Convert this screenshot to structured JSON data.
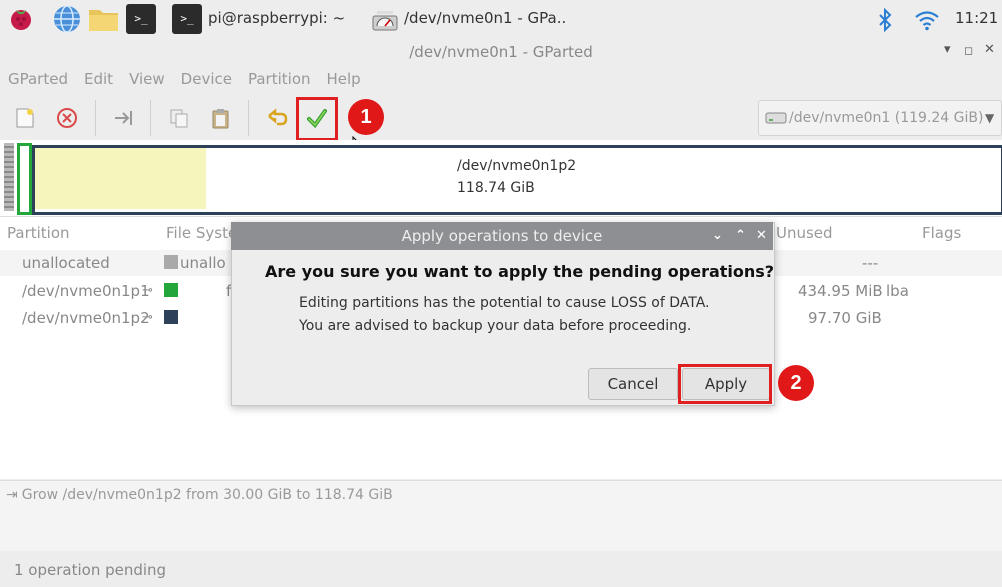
{
  "taskbar": {
    "terminal_window_label": "pi@raspberrypi: ~",
    "gparted_window_label": "/dev/nvme0n1 - GPa..",
    "clock": "11:21"
  },
  "window": {
    "title": "/dev/nvme0n1 - GParted"
  },
  "menu": [
    "GParted",
    "Edit",
    "View",
    "Device",
    "Partition",
    "Help"
  ],
  "device_selector": {
    "value": "/dev/nvme0n1 (119.24 GiB)"
  },
  "partition_map": {
    "name": "/dev/nvme0n1p2",
    "size": "118.74 GiB"
  },
  "list": {
    "headers": {
      "partition": "Partition",
      "filesystem": "File Syste",
      "unused": "Unused",
      "flags": "Flags"
    },
    "rows": [
      {
        "partition": "unallocated",
        "filesystem": "unallo",
        "unused": "---",
        "flags": ""
      },
      {
        "partition": "/dev/nvme0n1p1",
        "filesystem": "f",
        "unused": "434.95 MiB",
        "flags": "lba"
      },
      {
        "partition": "/dev/nvme0n1p2",
        "filesystem": "",
        "unused": "97.70 GiB",
        "flags": ""
      }
    ]
  },
  "colors": {
    "unallocated": "#a9a9a9",
    "fat": "#23a73a",
    "ext4": "#2d4159",
    "highlight": "#e02020"
  },
  "log": {
    "operation": "Grow /dev/nvme0n1p2 from 30.00 GiB to 118.74 GiB"
  },
  "status": "1 operation pending",
  "dialog": {
    "title": "Apply operations to device",
    "question": "Are you sure you want to apply the pending operations?",
    "line1": "Editing partitions has the potential to cause LOSS of DATA.",
    "line2": "You are advised to backup your data before proceeding.",
    "cancel": "Cancel",
    "apply": "Apply"
  },
  "annotations": {
    "step1": "1",
    "step2": "2"
  }
}
